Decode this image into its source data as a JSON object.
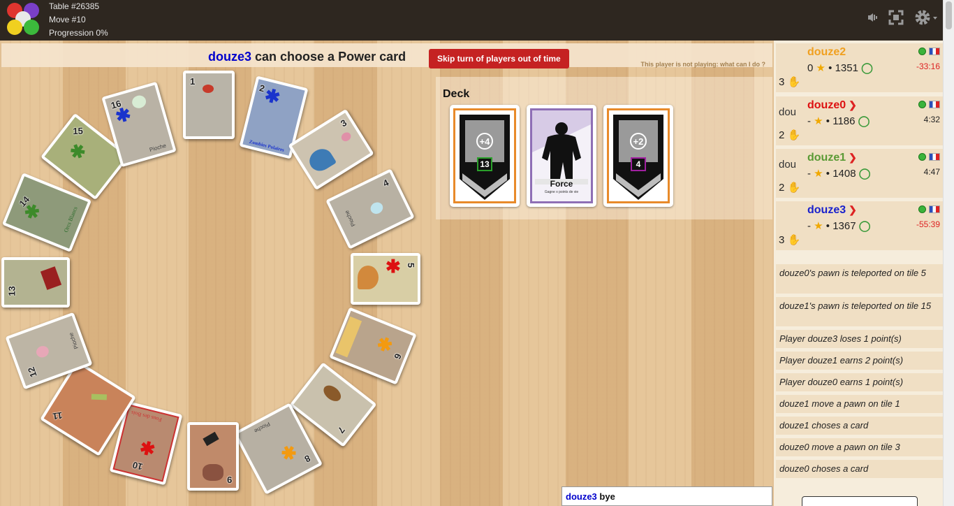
{
  "topbar": {
    "table": "Table #26385",
    "move": "Move #10",
    "progression": "Progression 0%"
  },
  "header": {
    "player": "douze3",
    "message": " can choose a Power card",
    "skip_button": "Skip turn of players out of time",
    "not_playing": "This player is not playing: what can I do ?"
  },
  "deck": {
    "title": "Deck",
    "cards": [
      {
        "type": "arrow",
        "top_value": "+4",
        "bottom_value": "13",
        "accent": "#e88a2a",
        "box": "#2aa02a"
      },
      {
        "type": "force",
        "name": "Force",
        "subtitle": "Gagne x points de vie",
        "accent": "#8e6fb5"
      },
      {
        "type": "arrow",
        "top_value": "+2",
        "bottom_value": "4",
        "accent": "#e88a2a",
        "box": "#a020a0"
      }
    ]
  },
  "board": {
    "tiles": [
      {
        "num": "1"
      },
      {
        "num": "2",
        "label": "Zombies Polaires"
      },
      {
        "num": "3"
      },
      {
        "num": "4",
        "label": "Pioche"
      },
      {
        "num": "5"
      },
      {
        "num": "6"
      },
      {
        "num": "7"
      },
      {
        "num": "8",
        "label": "Pioche"
      },
      {
        "num": "9"
      },
      {
        "num": "10",
        "label": "Fous des Bois"
      },
      {
        "num": "11"
      },
      {
        "num": "12",
        "label": "Pioche"
      },
      {
        "num": "13"
      },
      {
        "num": "14",
        "label": "Orcs Blancs"
      },
      {
        "num": "15"
      },
      {
        "num": "16",
        "label": "Pioche"
      }
    ],
    "colors": {
      "blue": "#1a33cc",
      "green": "#3d8a2a",
      "red": "#dd1111",
      "orange": "#f39a10"
    }
  },
  "players": [
    {
      "name": "douze2",
      "color": "#f0a020",
      "score": "0",
      "elo": "1351",
      "hand": "3",
      "time": "-33:16",
      "time_color": "#dd2222",
      "avatar": "",
      "active": false
    },
    {
      "name": "douze0",
      "color": "#dd1111",
      "score": "-",
      "elo": "1186",
      "hand": "2",
      "time": "4:32",
      "time_color": "#222222",
      "avatar": "dou",
      "active": true
    },
    {
      "name": "douze1",
      "color": "#5a9a35",
      "score": "-",
      "elo": "1408",
      "hand": "2",
      "time": "4:47",
      "time_color": "#222222",
      "avatar": "dou",
      "active": true
    },
    {
      "name": "douze3",
      "color": "#1a22cc",
      "score": "-",
      "elo": "1367",
      "hand": "3",
      "time": "-55:39",
      "time_color": "#dd2222",
      "avatar": "",
      "active": true
    }
  ],
  "log": [
    "douze0's pawn is teleported on tile 5",
    "douze1's pawn is teleported on tile 15",
    "Player douze3 loses 1 point(s)",
    "Player douze1 earns 2 point(s)",
    "Player douze0 earns 1 point(s)",
    "douze1 move a pawn on tile 1",
    "douze1 choses a card",
    "douze0 move a pawn on tile 3",
    "douze0 choses a card"
  ],
  "chat": {
    "who": "douze3",
    "text": "bye"
  }
}
